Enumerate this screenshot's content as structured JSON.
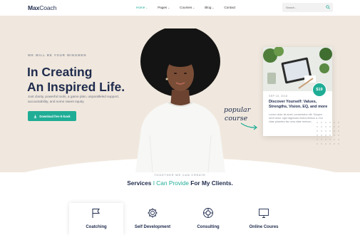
{
  "brand": {
    "logo_part1": "Max",
    "logo_part2": "Coach"
  },
  "nav": {
    "items": [
      {
        "label": "Home",
        "has_dropdown": true,
        "active": true
      },
      {
        "label": "Pages",
        "has_dropdown": true
      },
      {
        "label": "Courses",
        "has_dropdown": true
      },
      {
        "label": "Blog",
        "has_dropdown": true
      },
      {
        "label": "Contact",
        "has_dropdown": false
      }
    ]
  },
  "search": {
    "placeholder": "Search..."
  },
  "hero": {
    "eyebrow": "WE WILL BE YOUR WINGMEN",
    "title_line1": "In Creating",
    "title_line2": "An Inspired Life.",
    "description": "Just clarity, powerful tools, a game plan, unparalleled support, accountability, and some sweet equity.",
    "cta_label": "Download free E-book",
    "script_text_1": "popular",
    "script_text_2": "course"
  },
  "course_card": {
    "price": "$19",
    "date": "SEP 15, 2018",
    "title": "Discover Yourself: Values, Strengths, Vision, EQ, and more",
    "description": "Lorem dolor sit amet, consectetur elit. Suspen sectr dolor, eget dignissim lectus finibus a. Dui vitae pharetra fac urna vitae rermum."
  },
  "services": {
    "eyebrow": "TOGETHER WE CAN CREATE",
    "title_part1": "Services",
    "title_part2": "I Can Provide",
    "title_part3": "For My Clients.",
    "items": [
      {
        "label": "Coatching",
        "icon": "flag-icon",
        "highlight": true
      },
      {
        "label": "Self Development",
        "icon": "gear-icon"
      },
      {
        "label": "Consulting",
        "icon": "lifebuoy-icon"
      },
      {
        "label": "Online Coures",
        "icon": "monitor-icon"
      }
    ]
  },
  "colors": {
    "accent": "#20ad96",
    "navy": "#1f2b4d",
    "hero_bg": "#f0e8de"
  }
}
